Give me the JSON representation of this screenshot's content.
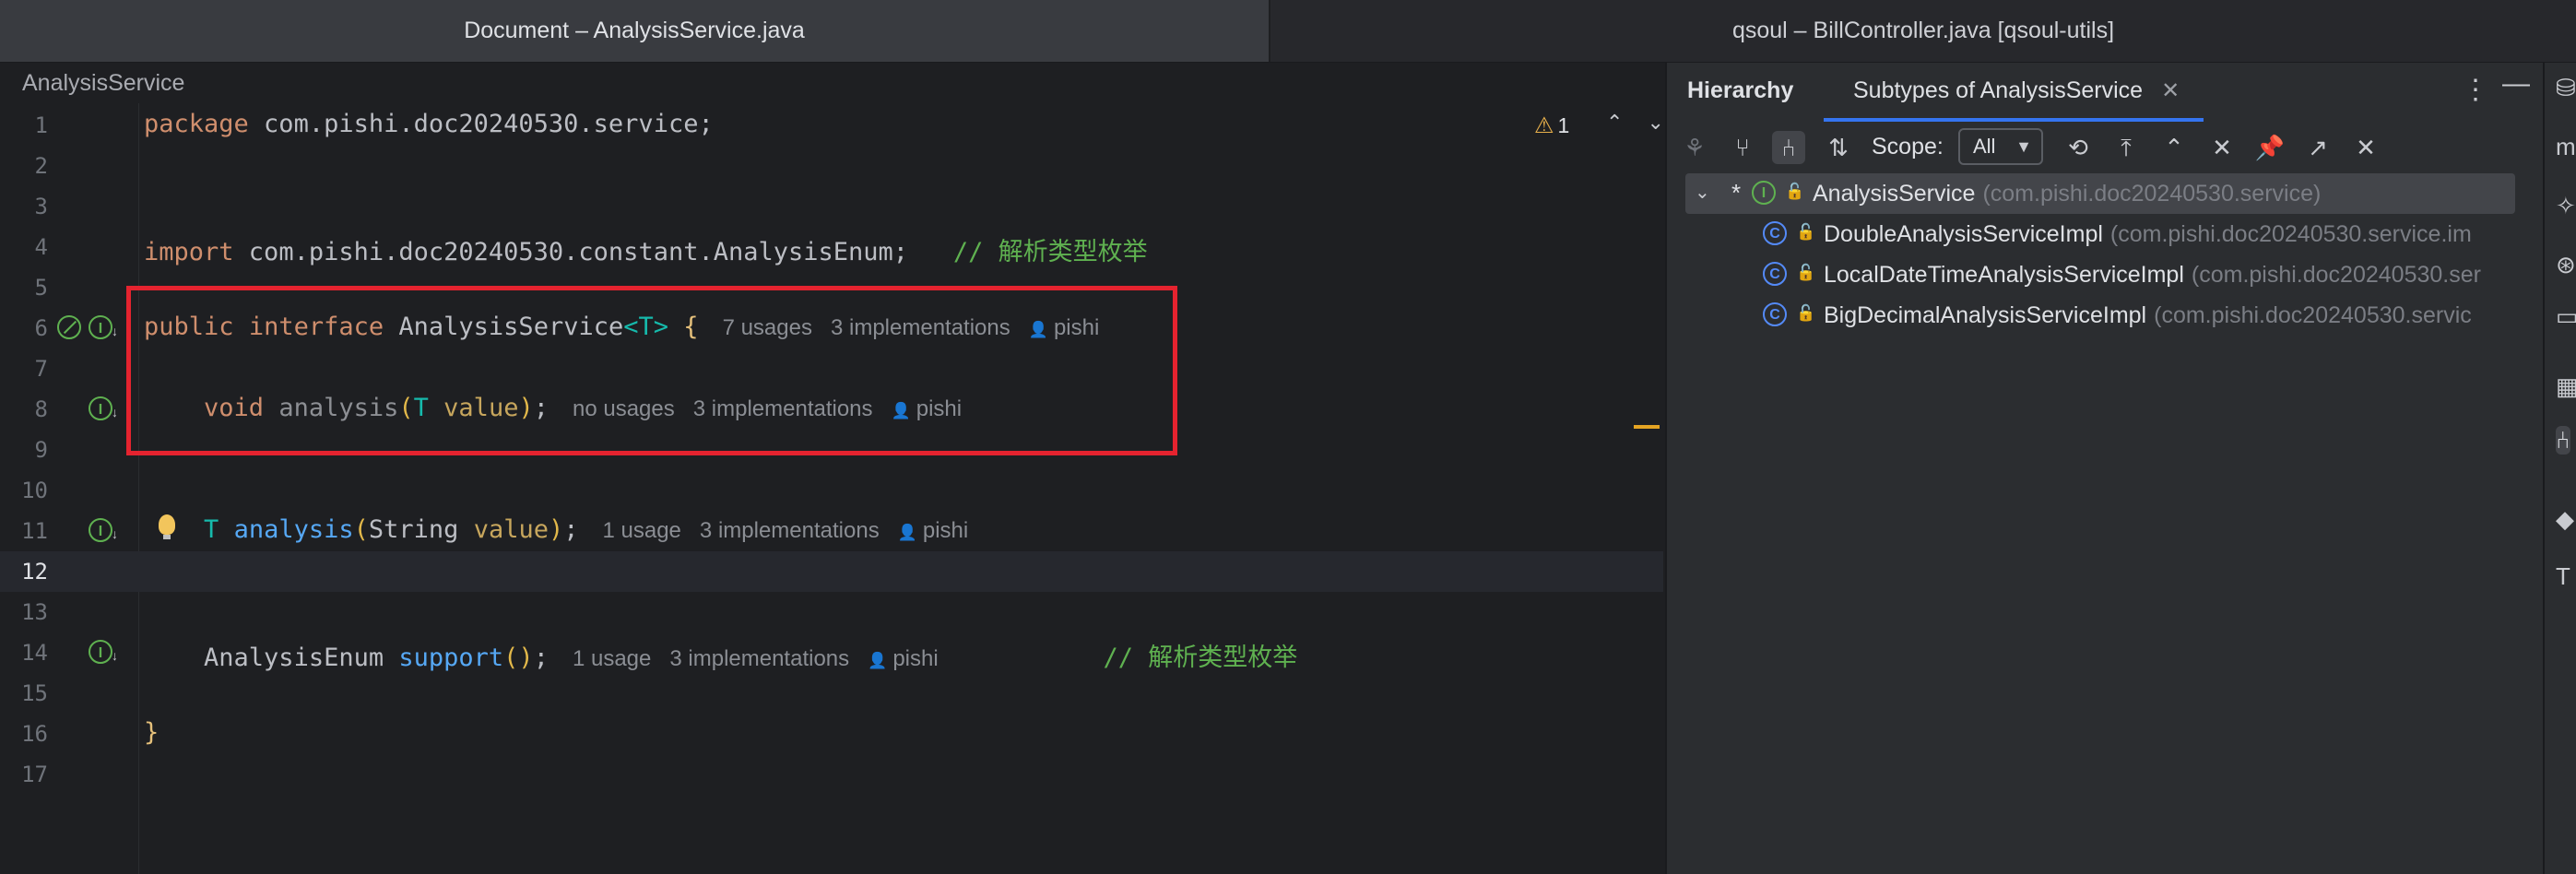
{
  "window_tabs": [
    {
      "label": "Document – AnalysisService.java"
    },
    {
      "label": "qsoul – BillController.java [qsoul-utils]"
    }
  ],
  "breadcrumb": "AnalysisService",
  "editor": {
    "lines": [
      "1",
      "2",
      "3",
      "4",
      "5",
      "6",
      "7",
      "8",
      "9",
      "10",
      "11",
      "12",
      "13",
      "14",
      "15",
      "16",
      "17"
    ],
    "current_line": "12",
    "code": {
      "l1_kw": "package",
      "l1_rest": " com.pishi.doc20240530.service;",
      "l4_kw": "import",
      "l4_rest": " com.pishi.doc20240530.constant.AnalysisEnum;",
      "l4_comment": "// 解析类型枚举",
      "l6_kw1": "public",
      "l6_kw2": "interface",
      "l6_name": "AnalysisService",
      "l6_gen_open": "<",
      "l6_gen": "T",
      "l6_gen_close": ">",
      "l6_brace": "{",
      "l8_kw": "void",
      "l8_fn": "analysis",
      "l8_po": "(",
      "l8_type": "T",
      "l8_param": "value",
      "l8_pc": ")",
      "l8_semi": ";",
      "l11_type": "T",
      "l11_fn": "analysis",
      "l11_po": "(",
      "l11_ptype": "String",
      "l11_param": "value",
      "l11_pc": ")",
      "l11_semi": ";",
      "l14_type": "AnalysisEnum",
      "l14_fn": "support",
      "l14_parens": "()",
      "l14_semi": ";",
      "l14_comment": "// 解析类型枚举",
      "l16_brace": "}"
    },
    "hints": {
      "l6": {
        "usages": "7 usages",
        "impl": "3 implementations",
        "author": "pishi"
      },
      "l8": {
        "usages": "no usages",
        "impl": "3 implementations",
        "author": "pishi"
      },
      "l11": {
        "usages": "1 usage",
        "impl": "3 implementations",
        "author": "pishi"
      },
      "l14": {
        "usages": "1 usage",
        "impl": "3 implementations",
        "author": "pishi"
      }
    },
    "warnings_count": "1",
    "highlight_color": "#e5232f"
  },
  "hierarchy": {
    "title": "Hierarchy",
    "tab_label": "Subtypes of AnalysisService",
    "scope_label": "Scope:",
    "scope_value": "All",
    "root": {
      "marker": "*",
      "name": "AnalysisService",
      "package": "(com.pishi.doc20240530.service)"
    },
    "children": [
      {
        "name": "DoubleAnalysisServiceImpl",
        "package": "(com.pishi.doc20240530.service.im"
      },
      {
        "name": "LocalDateTimeAnalysisServiceImpl",
        "package": "(com.pishi.doc20240530.ser"
      },
      {
        "name": "BigDecimalAnalysisServiceImpl",
        "package": "(com.pishi.doc20240530.servic"
      }
    ]
  },
  "colors": {
    "keyword": "#cf8e6d",
    "comment": "#5fb150",
    "function": "#56a8f5",
    "accent": "#3574f0"
  }
}
